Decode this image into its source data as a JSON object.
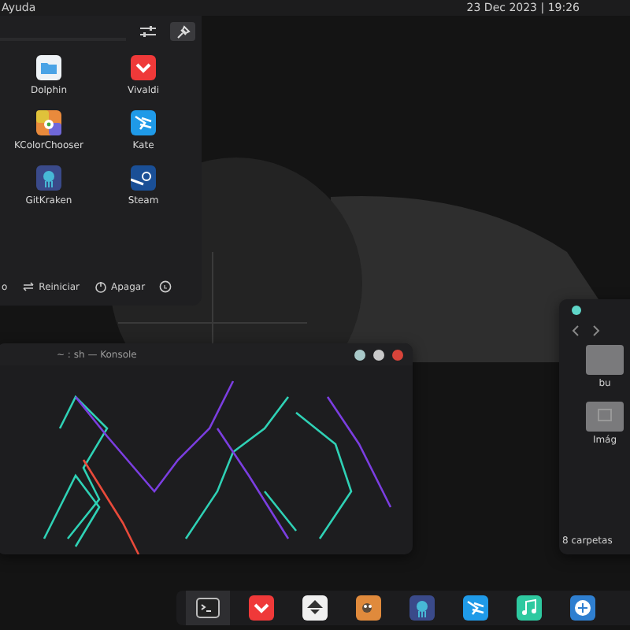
{
  "top_bar": {
    "menu_label": "Ayuda",
    "clock": "23 Dec 2023 | 19:26"
  },
  "launcher": {
    "apps": [
      {
        "name": "Dolphin",
        "kind": "folder"
      },
      {
        "name": "Vivaldi",
        "kind": "vivaldi"
      },
      {
        "name": "KColorChooser",
        "kind": "color"
      },
      {
        "name": "Kate",
        "kind": "kate"
      },
      {
        "name": "GitKraken",
        "kind": "kraken"
      },
      {
        "name": "Steam",
        "kind": "steam"
      }
    ],
    "power": [
      {
        "kind": "suspend",
        "label": "o"
      },
      {
        "kind": "restart",
        "label": "Reiniciar"
      },
      {
        "kind": "shutdown",
        "label": "Apagar"
      }
    ]
  },
  "konsole": {
    "title": "~ : sh — Konsole"
  },
  "file_manager": {
    "items": [
      {
        "name": "bu",
        "kind": "folder"
      },
      {
        "name": "Imág",
        "kind": "images"
      }
    ],
    "status": "8 carpetas"
  },
  "dock": {
    "items": [
      {
        "kind": "terminal",
        "selected": true
      },
      {
        "kind": "vivaldi",
        "selected": false
      },
      {
        "kind": "inkscape",
        "selected": false
      },
      {
        "kind": "gimp",
        "selected": false
      },
      {
        "kind": "kraken",
        "selected": false
      },
      {
        "kind": "kate",
        "selected": false
      },
      {
        "kind": "music",
        "selected": false
      },
      {
        "kind": "qbit",
        "selected": false
      }
    ]
  }
}
